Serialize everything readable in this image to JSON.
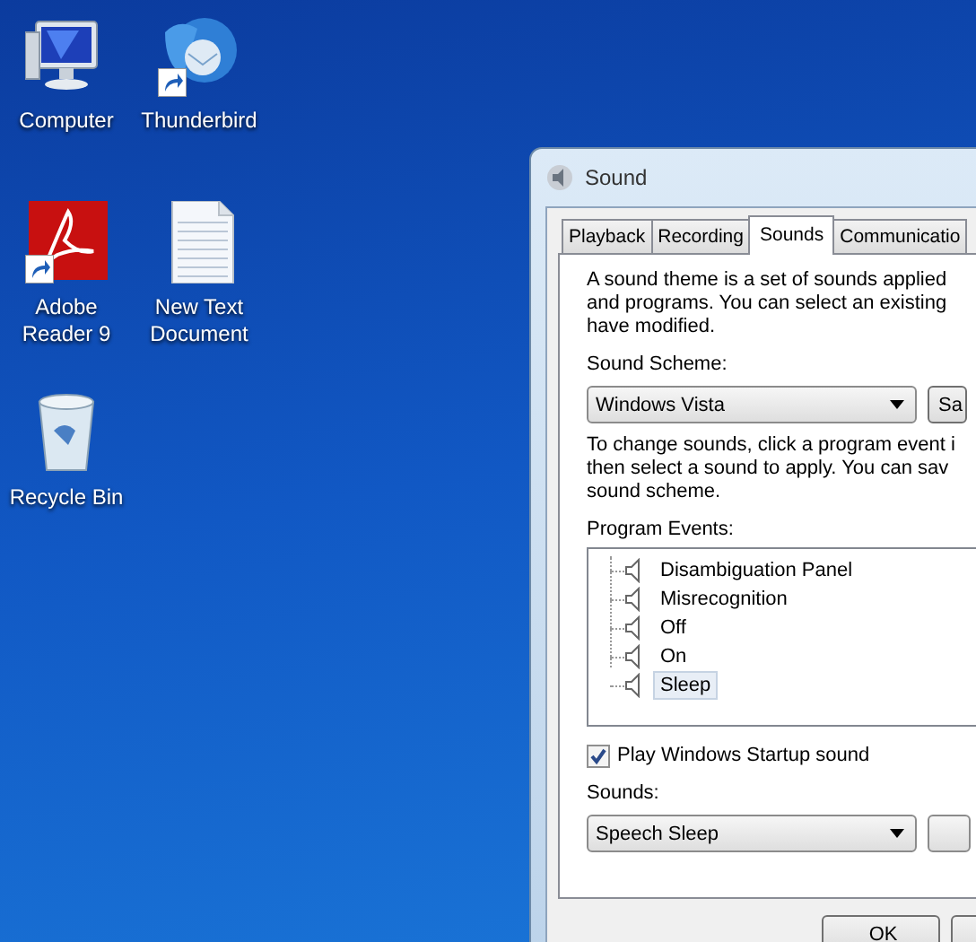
{
  "desktop_icons": [
    {
      "label": "Computer",
      "kind": "computer",
      "shortcut": false
    },
    {
      "label": "Thunderbird",
      "kind": "mail",
      "shortcut": true
    },
    {
      "label": "Adobe\nReader 9",
      "kind": "pdf",
      "shortcut": true
    },
    {
      "label": "New Text\nDocument",
      "kind": "text",
      "shortcut": false
    },
    {
      "label": "Recycle Bin",
      "kind": "bin",
      "shortcut": false
    }
  ],
  "window": {
    "title": "Sound",
    "tabs": [
      {
        "label": "Playback",
        "selected": false
      },
      {
        "label": "Recording",
        "selected": false
      },
      {
        "label": "Sounds",
        "selected": true
      },
      {
        "label": "Communicatio",
        "selected": false
      }
    ],
    "intro_lines": [
      "A sound theme is a set of sounds applied",
      "and programs.  You can select an existing",
      "have modified."
    ],
    "scheme_label": "Sound Scheme:",
    "scheme_value": "Windows Vista",
    "save_button": "Sa",
    "help_lines": [
      "To change sounds, click a program event i",
      "then select a sound to apply.  You can sav",
      "sound scheme."
    ],
    "events_label": "Program Events:",
    "events": [
      {
        "label": "Disambiguation Panel",
        "selected": false
      },
      {
        "label": "Misrecognition",
        "selected": false
      },
      {
        "label": "Off",
        "selected": false
      },
      {
        "label": "On",
        "selected": false
      },
      {
        "label": "Sleep",
        "selected": true
      }
    ],
    "startup_sound": {
      "label": "Play Windows Startup sound",
      "checked": true
    },
    "sounds_label": "Sounds:",
    "sounds_value": "Speech Sleep",
    "ok_button": "OK"
  }
}
